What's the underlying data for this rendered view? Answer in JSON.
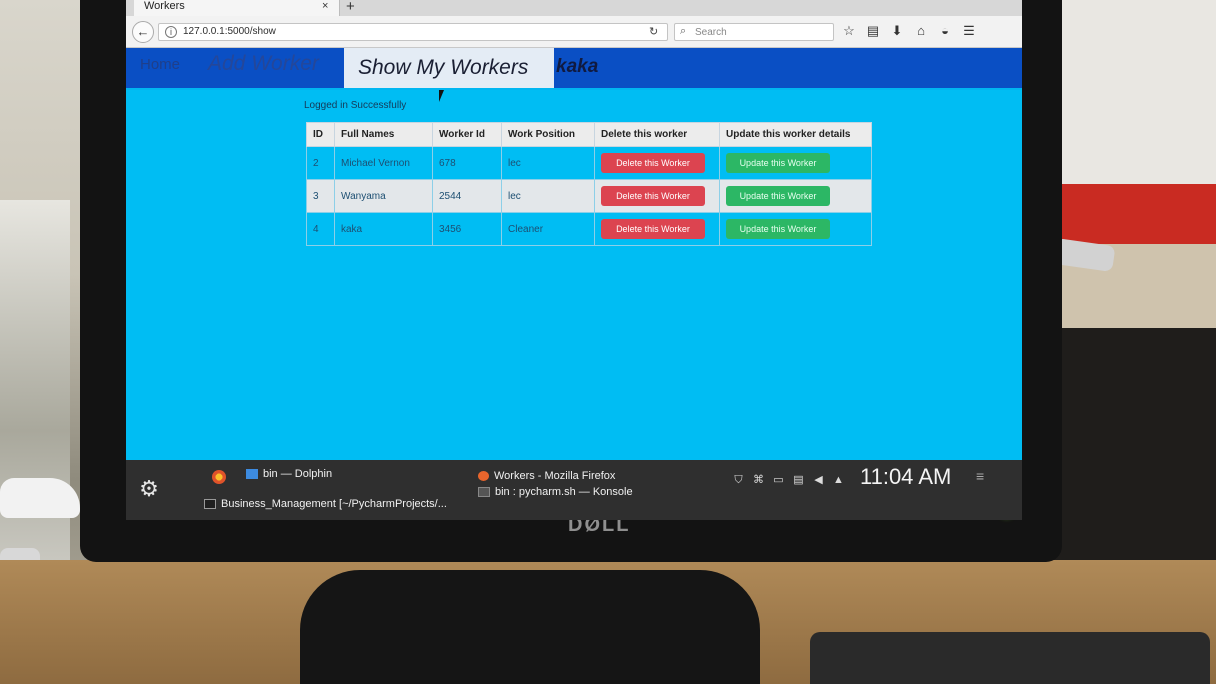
{
  "browser": {
    "tab_title": "Workers",
    "tab_close": "×",
    "new_tab": "+",
    "url": "127.0.0.1:5000/show",
    "search_placeholder": "Search"
  },
  "app_nav": {
    "home": "Home",
    "add_worker": "Add Worker",
    "show_my_workers": "Show My Workers",
    "user": "kaka"
  },
  "status_message": "Logged in Successfully",
  "workers_table": {
    "headers": [
      "ID",
      "Full Names",
      "Worker Id",
      "Work Position",
      "Delete this worker",
      "Update this worker details"
    ],
    "rows": [
      {
        "id": "2",
        "full_name": "Michael Vernon",
        "worker_id": "678",
        "position": "lec",
        "delete_label": "Delete this Worker",
        "update_label": "Update this Worker"
      },
      {
        "id": "3",
        "full_name": "Wanyama",
        "worker_id": "2544",
        "position": "lec",
        "delete_label": "Delete this Worker",
        "update_label": "Update this Worker"
      },
      {
        "id": "4",
        "full_name": "kaka",
        "worker_id": "3456",
        "position": "Cleaner",
        "delete_label": "Delete this Worker",
        "update_label": "Update this Worker"
      }
    ]
  },
  "taskbar": {
    "dolphin": "bin — Dolphin",
    "firefox_window": "Workers - Mozilla Firefox",
    "pycharm": "Business_Management [~/PycharmProjects/...",
    "konsole": "bin : pycharm.sh — Konsole",
    "clock": "11:04 AM"
  },
  "monitor": {
    "brand": "DØLL"
  },
  "colors": {
    "page_background": "#00b6f1",
    "nav_bar": "#0a4fc4",
    "delete_button": "#dc4450",
    "update_button": "#2cb765"
  }
}
